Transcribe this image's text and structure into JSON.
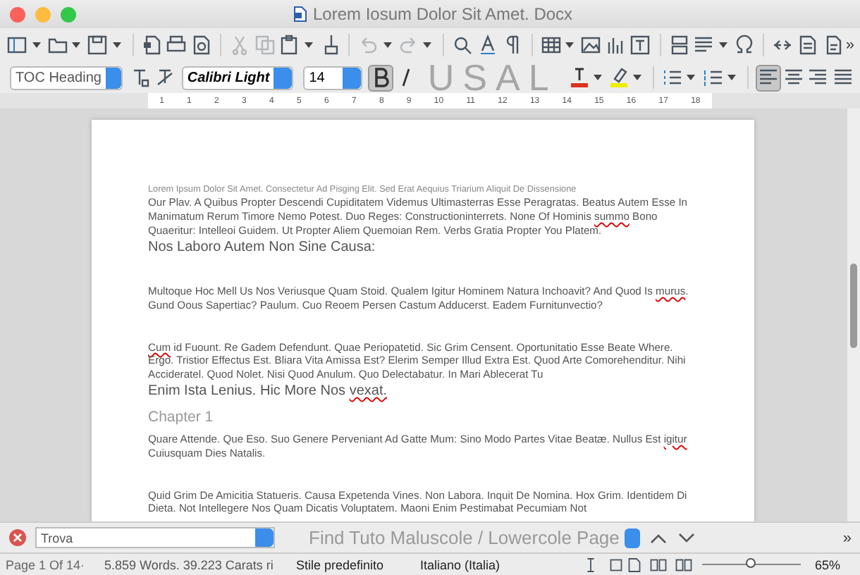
{
  "window": {
    "title": "Lorem Iosum Dolor Sit Amet. Docx"
  },
  "toolbar": {
    "overflow": "»"
  },
  "format_bar": {
    "paragraph_style": "TOC Heading",
    "font": "Calibri Light",
    "size": "14",
    "overlay_text": "USAL",
    "toggles": [
      {
        "kind": "bold",
        "selected": true
      },
      {
        "kind": "italic",
        "selected": false
      }
    ],
    "alignments": [
      {
        "kind": "left",
        "selected": true
      },
      {
        "kind": "center",
        "selected": false
      },
      {
        "kind": "right",
        "selected": false
      },
      {
        "kind": "justify",
        "selected": false
      }
    ]
  },
  "ruler": {
    "numbers": [
      "1",
      "1",
      "2",
      "3",
      "4",
      "5",
      "6",
      "7",
      "8",
      "9",
      "10",
      "11",
      "12",
      "13",
      "14",
      "15",
      "16",
      "17",
      "18"
    ]
  },
  "document": {
    "blocks": [
      {
        "kind": "small",
        "spans": [
          {
            "text": "Lorem Ipsum Dolor Sit Amet. Consectetur Ad Pisging Elit. Sed Erat Aequius Triarium Aliquit De Dissensione",
            "misspelled": false
          }
        ]
      },
      {
        "kind": "body",
        "spans": [
          {
            "text": "Our Plav. A Quibus Propter Descendi Cupiditatem Videmus Ultimasterras Esse Peragratas. Beatus Autem Esse In Manimatum Rerum Timore Nemo Potest. Duo Reges: Constructioninterrets. None Of Hominis ",
            "misspelled": false
          },
          {
            "text": "summo",
            "misspelled": true
          },
          {
            "text": " Bono Quaeritur: Intelleoi Guidem. Ut Propter Aliem Quemoian Rem. Verbs Gratia Propter You Platem.",
            "misspelled": false
          }
        ]
      },
      {
        "kind": "large",
        "spans": [
          {
            "text": "Nos Laboro Autem Non Sine Causa:",
            "misspelled": false
          }
        ]
      },
      {
        "kind": "body",
        "spans": [
          {
            "text": "Multoque Hoc Mell Us Nos Veriusque Quam Stoid. Qualem Igitur Hominem Natura Inchoavit? And Quod Is ",
            "misspelled": false
          },
          {
            "text": "murus",
            "misspelled": true
          },
          {
            "text": ". Gund Oous Sapertiac? Paulum. Cuo Reoem Persen Castum Adducerst. Eadem Furnitunvectio?",
            "misspelled": false
          }
        ]
      },
      {
        "kind": "body",
        "spans": [
          {
            "text": "Cum",
            "misspelled": true
          },
          {
            "text": " id Fuount. Re Gadem Defendunt. Quae Periopatetid. Sic Grim Censent. Oportunitatio Esse Beate Where. Ergo. Tristior Effectus Est. Bliara Vita Amissa Est? Elerim Semper Illud Extra Est. Quod Arte Comorehenditur. Nihi Accideratel. Quod Nolet. Nisi Quod Anulum. Quo Delectabatur. In Mari Ablecerat Tu",
            "misspelled": false
          }
        ]
      },
      {
        "kind": "large",
        "spans": [
          {
            "text": "Enim Ista Lenius. Hic More Nos ",
            "misspelled": false
          },
          {
            "text": "vexat.",
            "misspelled": true
          }
        ]
      },
      {
        "kind": "heading",
        "spans": [
          {
            "text": "Chapter 1",
            "misspelled": false
          }
        ]
      },
      {
        "kind": "body",
        "spans": [
          {
            "text": "Quare Attende. Que Eso. Suo Genere Perveniant Ad Gatte Mum: Sino Modo Partes Vitae Beatæ. Nullus Est ",
            "misspelled": false
          },
          {
            "text": "igitur",
            "misspelled": true
          },
          {
            "text": " Cuiusquam Dies Natalis.",
            "misspelled": false
          }
        ]
      },
      {
        "kind": "body",
        "spans": [
          {
            "text": "Quid Grim De Amicitia Statueris. Causa Expetenda Vines. Non Labora. Inquit De Nomina. Hox Grim. Identidem Di Dieta. Not Intellegere Nos Quam Dicatis Voluptatem. Maoni Enim Pestimabat Pecumiam Not",
            "misspelled": false
          }
        ]
      }
    ]
  },
  "find_bar": {
    "value": "Trova",
    "label": "Find Tuto Maluscole / Lowercole Page",
    "overflow": "»"
  },
  "status_bar": {
    "page": "Page 1 Of 14·",
    "counts": "5.859 Words. 39.223 Carats ri",
    "style": "Stile predefinito",
    "language": "Italiano (Italia)",
    "zoom": {
      "level": 0.5
    },
    "zoom_text": "65%"
  }
}
